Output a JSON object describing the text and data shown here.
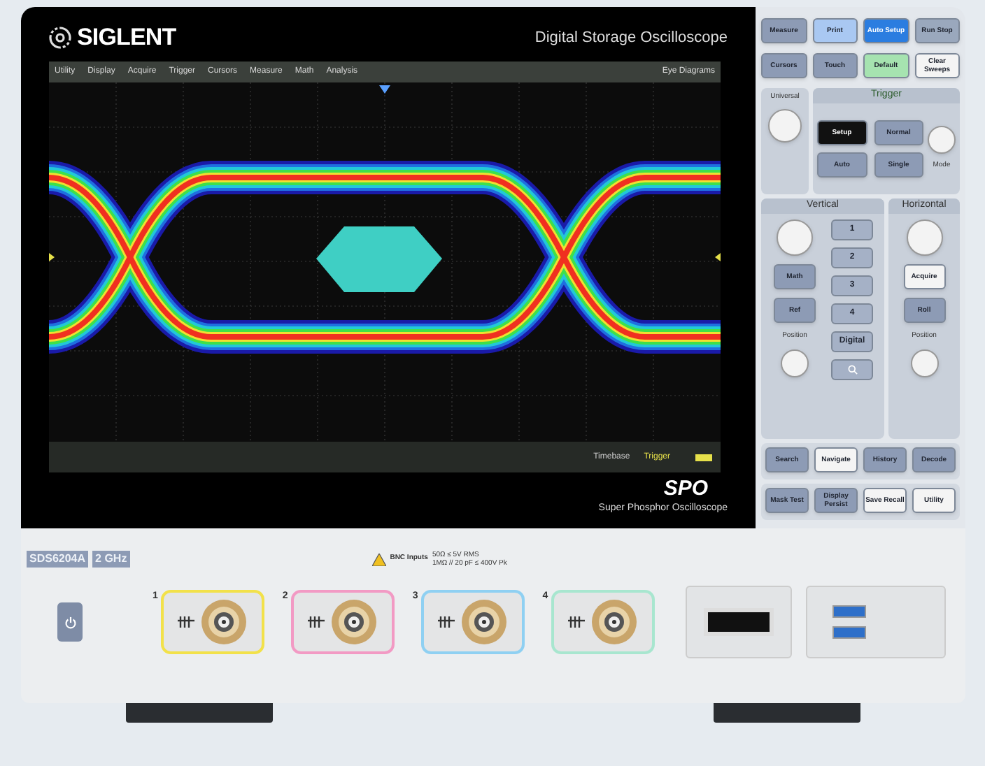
{
  "brand": "SIGLENT",
  "title": "Digital Storage Oscilloscope",
  "menu": [
    {
      "label": "Utility"
    },
    {
      "label": "Display"
    },
    {
      "label": "Acquire"
    },
    {
      "label": "Trigger"
    },
    {
      "label": "Cursors"
    },
    {
      "label": "Measure"
    },
    {
      "label": "Math"
    },
    {
      "label": "Analysis"
    }
  ],
  "mode_label": "Eye Diagrams",
  "info_bar": {
    "timebase": "Timebase",
    "trigger": "Trigger"
  },
  "spo": {
    "logo": "SPO",
    "caption": "Super Phosphor Oscilloscope"
  },
  "top_buttons": [
    {
      "label": "Measure",
      "color": "#8d9bb5"
    },
    {
      "label": "Print",
      "color": "#a9c8f2"
    },
    {
      "label": "Auto Setup",
      "color": "#2b7de0"
    },
    {
      "label": "Run Stop",
      "color": "#9aa8bd"
    },
    {
      "label": "Cursors",
      "color": "#8d9bb5"
    },
    {
      "label": "Touch",
      "color": "#8d9bb5"
    },
    {
      "label": "Default",
      "color": "#a6e3b0"
    },
    {
      "label": "Clear Sweeps",
      "color": "#f4f4f4"
    }
  ],
  "universal": {
    "label": "Universal"
  },
  "trigger": {
    "title": "Trigger",
    "buttons": [
      {
        "label": "Setup",
        "color": "#111111"
      },
      {
        "label": "Normal",
        "color": "#8d9bb5"
      },
      {
        "label": "Auto",
        "color": "#8d9bb5"
      },
      {
        "label": "Single",
        "color": "#8d9bb5"
      }
    ],
    "mode": "Mode"
  },
  "vertical": {
    "title": "Vertical",
    "buttons": [
      {
        "label": "Math",
        "color": "#8d9bb5"
      },
      {
        "label": "Ref",
        "color": "#8d9bb5"
      }
    ],
    "channels": [
      {
        "label": "1"
      },
      {
        "label": "2"
      },
      {
        "label": "3"
      },
      {
        "label": "4"
      },
      {
        "label": "Digital"
      }
    ],
    "position": "Position"
  },
  "horizontal": {
    "title": "Horizontal",
    "buttons": [
      {
        "label": "Acquire",
        "color": "#f4f4f4"
      },
      {
        "label": "Roll",
        "color": "#8d9bb5"
      }
    ],
    "position": "Position"
  },
  "bottom_buttons": [
    {
      "label": "Search",
      "color": "#8d9bb5"
    },
    {
      "label": "Navigate",
      "color": "#f4f4f4"
    },
    {
      "label": "History",
      "color": "#8d9bb5"
    },
    {
      "label": "Decode",
      "color": "#8d9bb5"
    },
    {
      "label": "Mask Test",
      "color": "#8d9bb5"
    },
    {
      "label": "Display Persist",
      "color": "#8d9bb5"
    },
    {
      "label": "Save Recall",
      "color": "#f4f4f4"
    },
    {
      "label": "Utility",
      "color": "#f4f4f4"
    }
  ],
  "front": {
    "model": "SDS6204A",
    "bandwidth": "2 GHz",
    "warning": "BNC Inputs",
    "specs": [
      "50Ω ≤ 5V RMS",
      "1MΩ // 20 pF ≤ 400V Pk"
    ],
    "channels": [
      {
        "number": "1",
        "color": "#f2e14a"
      },
      {
        "number": "2",
        "color": "#f29ac4"
      },
      {
        "number": "3",
        "color": "#8fd0f2"
      },
      {
        "number": "4",
        "color": "#a8e6cf"
      }
    ]
  }
}
